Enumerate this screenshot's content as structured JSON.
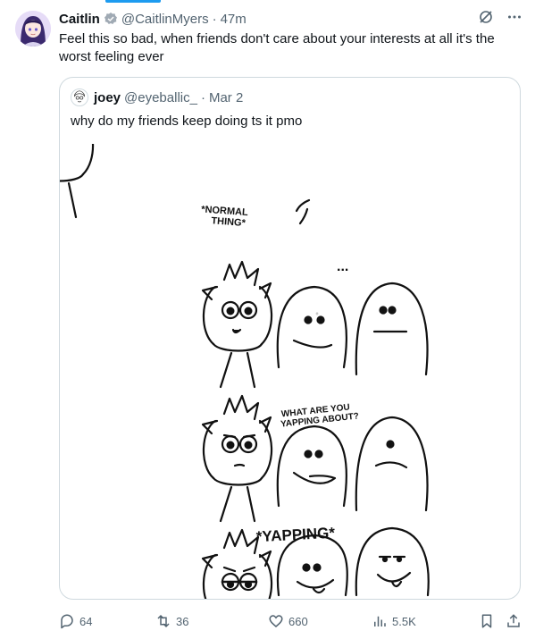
{
  "tweet": {
    "author_name": "Caitlin",
    "author_handle": "@CaitlinMyers",
    "separator": "·",
    "time": "47m",
    "text": "Feel this so bad, when friends don't care about your interests at all it's the worst feeling ever",
    "avatar_icon": "anime-girl-avatar",
    "verified_icon": "verified-badge-icon"
  },
  "quoted": {
    "author_name": "joey",
    "author_handle": "@eyeballic_",
    "separator": "·",
    "date": "Mar 2",
    "text": "why do my friends keep doing ts it pmo",
    "comic": {
      "panel1_caption": "*NORMAL THING*",
      "panel1_dots": "...",
      "panel2_caption": "WHAT ARE YOU YAPPING ABOUT?",
      "panel3_caption": "*YAPPING*"
    }
  },
  "actions": {
    "replies": "64",
    "reposts": "36",
    "likes": "660",
    "views": "5.5K"
  },
  "colors": {
    "accent": "#1d9bf0",
    "text_primary": "#0f1419",
    "text_secondary": "#536471",
    "border": "#cfd9de"
  }
}
